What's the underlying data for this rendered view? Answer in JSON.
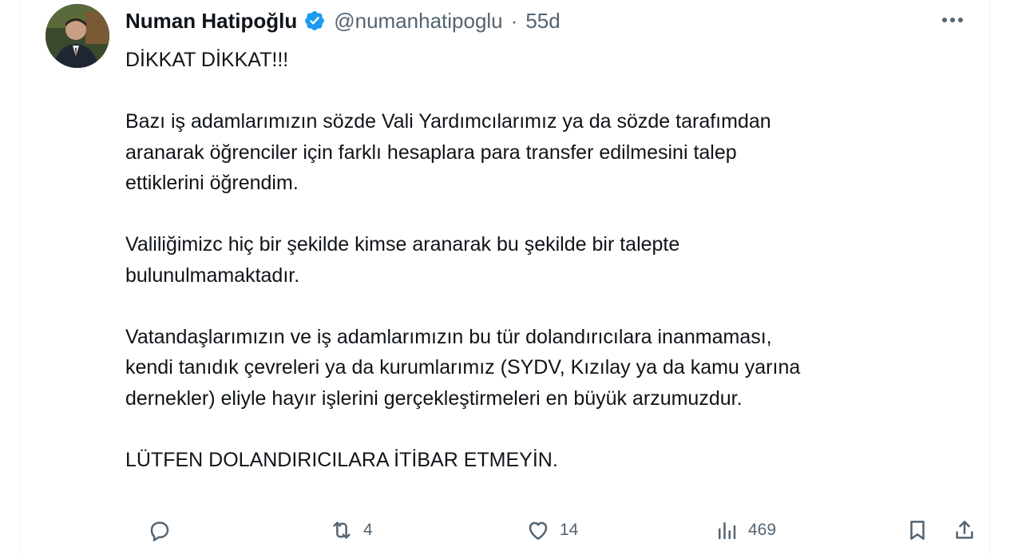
{
  "author": {
    "name": "Numan Hatipoğlu",
    "handle": "@numanhatipoglu",
    "separator": "·",
    "time": "55d",
    "verified": true,
    "verified_color": "#1d9bf0"
  },
  "tweet": {
    "paragraphs": [
      [
        "DİKKAT DİKKAT!!!"
      ],
      [
        "Bazı iş adamlarımızın sözde Vali Yardımcılarımız ya da sözde tarafımdan",
        "aranarak öğrenciler için farklı hesaplara para transfer edilmesini talep",
        "ettiklerini öğrendim."
      ],
      [
        "Valiliğimizc hiç bir şekilde kimse aranarak bu şekilde bir talepte",
        "bulunulmamaktadır."
      ],
      [
        "Vatandaşlarımızın ve iş adamlarımızın bu tür dolandırıcılara inanmaması,",
        "kendi tanıdık çevreleri ya da kurumlarımız (SYDV, Kızılay ya da kamu yarına",
        "dernekler) eliyle hayır işlerini  gerçekleştirmeleri en büyük arzumuzdur."
      ],
      [
        "LÜTFEN DOLANDIRICILARA İTİBAR ETMEYİN."
      ]
    ]
  },
  "actions": {
    "reply": {
      "icon": "reply-icon",
      "count": ""
    },
    "retweet": {
      "icon": "retweet-icon",
      "count": "4"
    },
    "like": {
      "icon": "heart-icon",
      "count": "14"
    },
    "views": {
      "icon": "views-icon",
      "count": "469"
    },
    "bookmark": {
      "icon": "bookmark-icon"
    },
    "share": {
      "icon": "share-icon"
    }
  },
  "colors": {
    "text": "#0f1419",
    "secondary": "#536471",
    "accent": "#1d9bf0"
  }
}
